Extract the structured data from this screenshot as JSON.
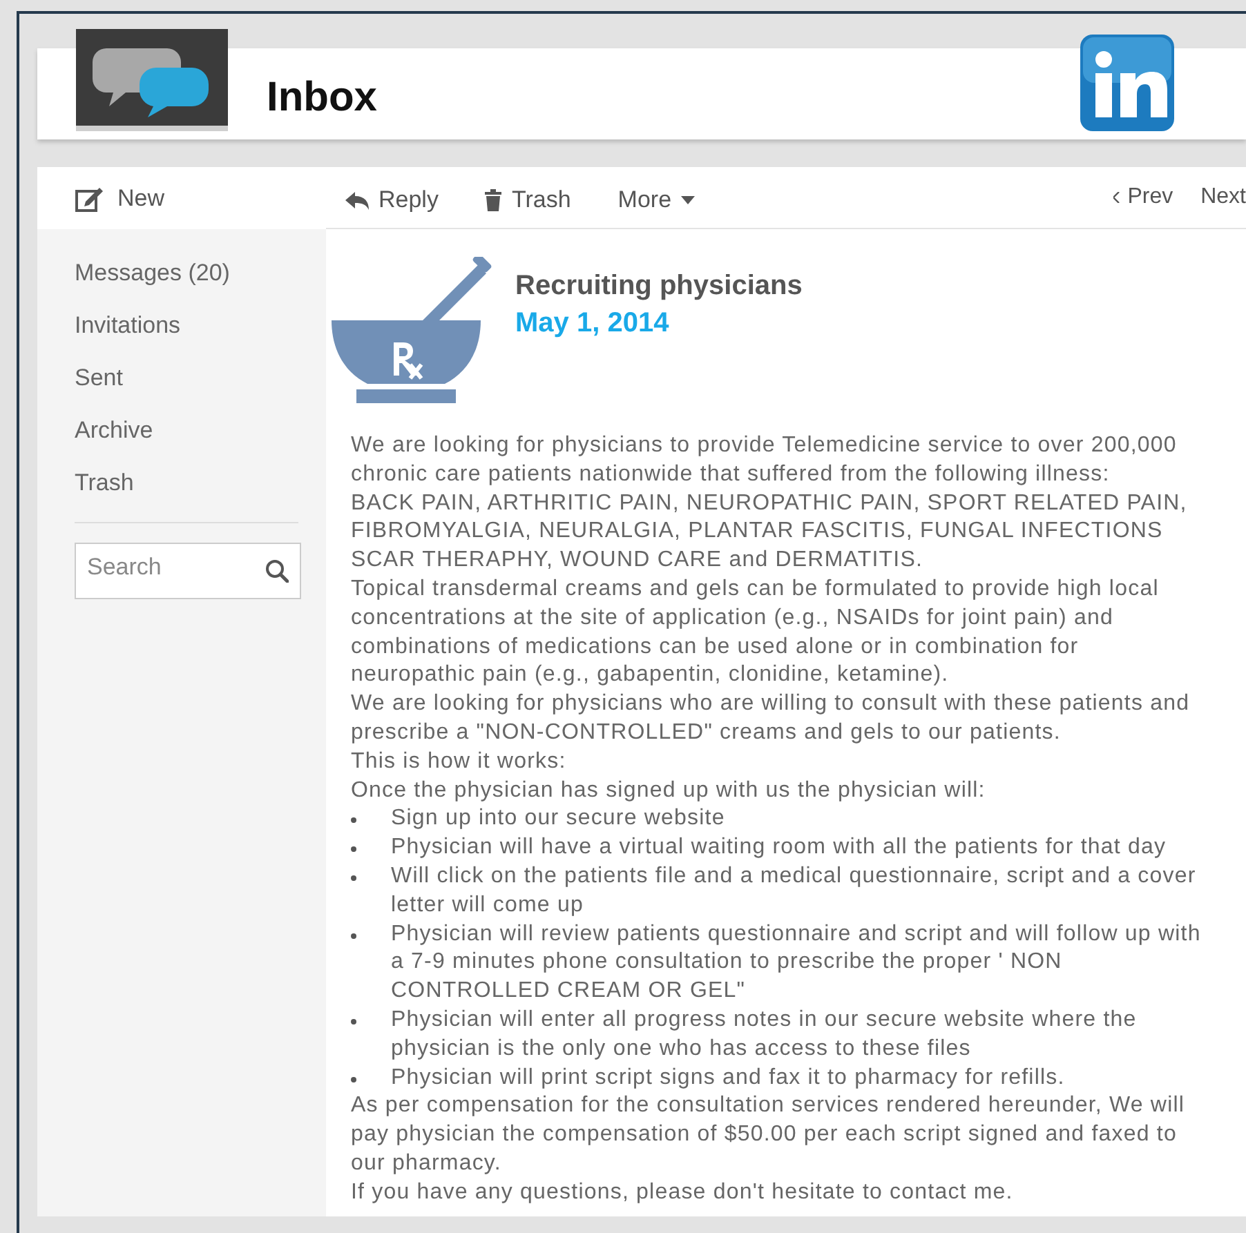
{
  "header": {
    "title": "Inbox"
  },
  "sidebar": {
    "new_label": "New",
    "items": [
      {
        "label": "Messages (20)"
      },
      {
        "label": "Invitations"
      },
      {
        "label": "Sent"
      },
      {
        "label": "Archive"
      },
      {
        "label": "Trash"
      }
    ],
    "search": {
      "placeholder": "Search"
    }
  },
  "toolbar": {
    "actions": [
      {
        "kind": "reply",
        "label": "Reply"
      },
      {
        "kind": "trash",
        "label": "Trash"
      },
      {
        "kind": "more",
        "label": "More"
      }
    ],
    "prev": "Prev",
    "next": "Next"
  },
  "message": {
    "subject": "Recruiting physicians",
    "date": "May 1, 2014",
    "body": [
      {
        "kind": "paragraph",
        "text": "We are looking for physicians to provide Telemedicine service to over 200,000 chronic care patients nationwide that suffered from the following illness:"
      },
      {
        "kind": "paragraph",
        "text": "BACK PAIN, ARTHRITIC PAIN, NEUROPATHIC PAIN, SPORT RELATED PAIN, FIBROMYALGIA, NEURALGIA, PLANTAR FASCITIS, FUNGAL INFECTIONS SCAR THERAPHY, WOUND CARE and DERMATITIS."
      },
      {
        "kind": "paragraph",
        "text": "Topical transdermal creams and gels can be formulated to provide high local concentrations at the site of application (e.g., NSAIDs for joint pain) and combinations of medications can be used alone or in combination for neuropathic pain (e.g., gabapentin, clonidine, ketamine)."
      },
      {
        "kind": "paragraph",
        "text": "We are looking for physicians who are willing to consult with these patients and prescribe a \"NON-CONTROLLED\" creams and gels to our patients."
      },
      {
        "kind": "paragraph",
        "text": "This is how it works:"
      },
      {
        "kind": "paragraph",
        "text": "Once the physician has signed up with us the physician will:"
      },
      {
        "kind": "bullet",
        "text": "Sign up into our secure website"
      },
      {
        "kind": "bullet",
        "text": "Physician will have a virtual waiting room with all the patients for that day"
      },
      {
        "kind": "bullet",
        "text": "Will click on the patients file and a medical questionnaire, script and a cover letter will come up"
      },
      {
        "kind": "bullet",
        "text": "Physician will review patients questionnaire and script and will follow up with a 7-9 minutes  phone consultation to prescribe the proper ' NON CONTROLLED CREAM OR GEL\""
      },
      {
        "kind": "bullet",
        "text": "Physician will enter all progress notes in our secure website where the physician is the only one who has access to these files"
      },
      {
        "kind": "bullet",
        "text": "Physician will print script signs and fax it to pharmacy for refills."
      },
      {
        "kind": "paragraph",
        "text": "As per compensation for the consultation services rendered hereunder, We will pay physician the compensation of $50.00 per each script signed and faxed to our pharmacy."
      },
      {
        "kind": "paragraph",
        "text": "If you have any questions, please don't hesitate to contact me."
      }
    ]
  }
}
